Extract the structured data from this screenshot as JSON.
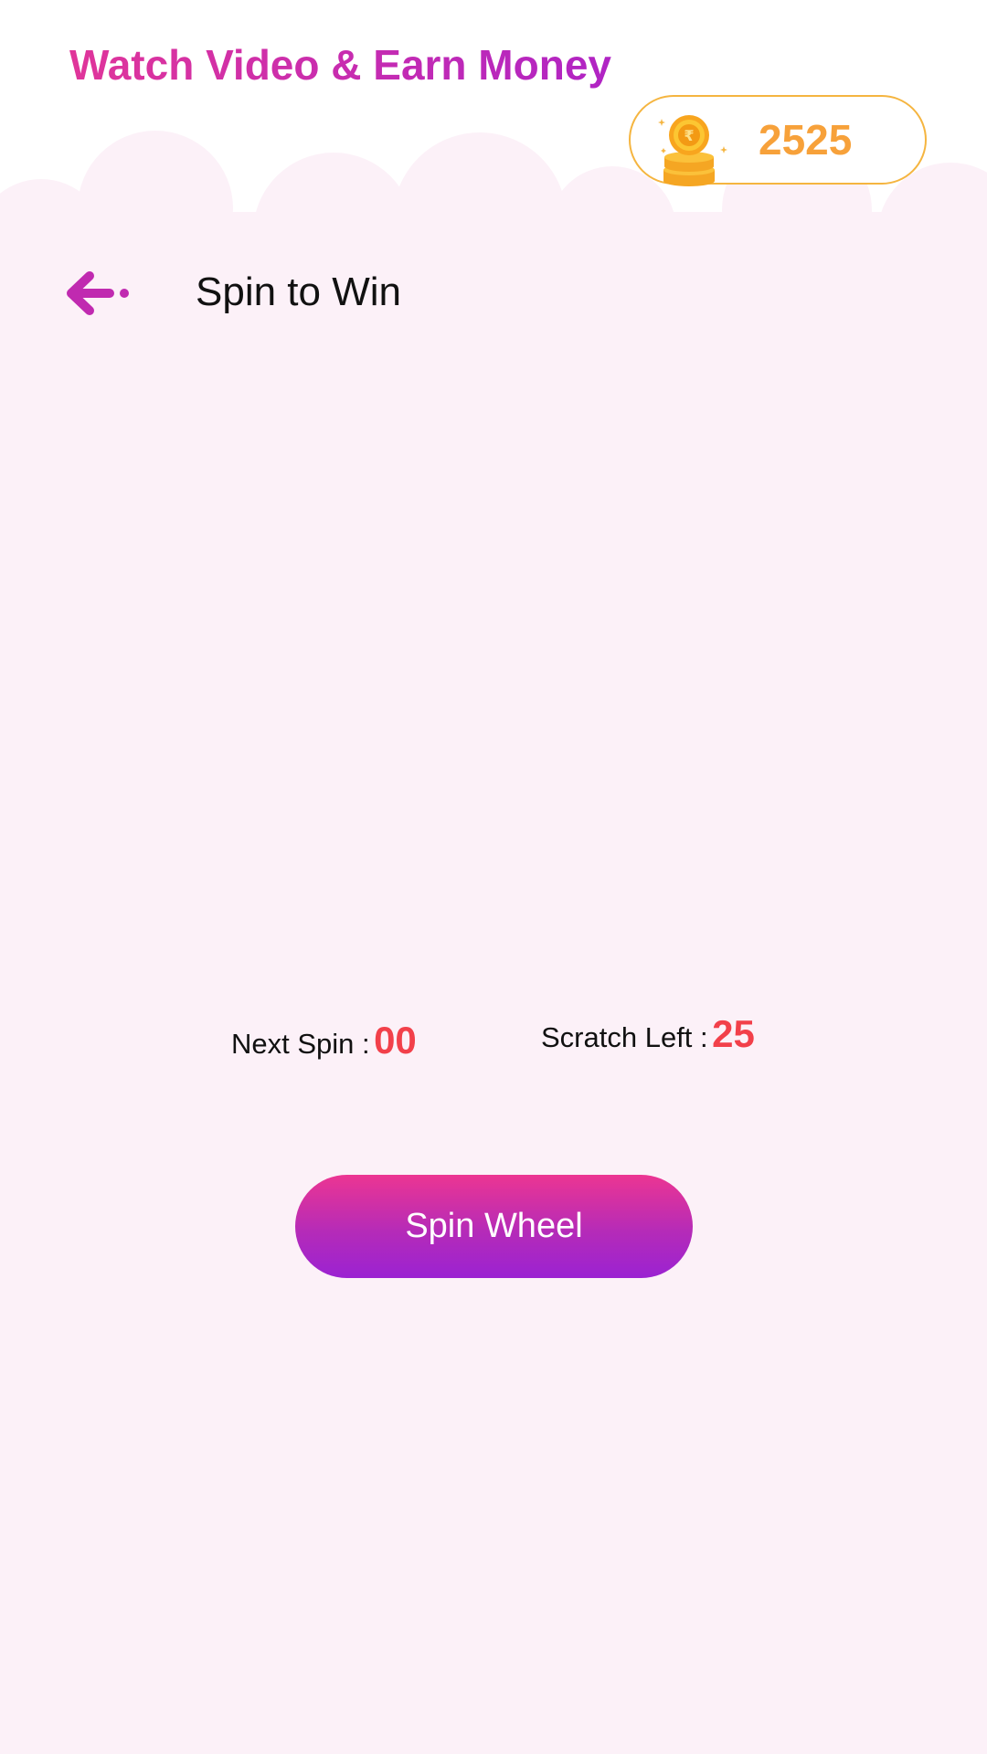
{
  "header": {
    "app_title": "Watch Video & Earn Money",
    "coin_balance": "2525",
    "coin_icon": "rupee-coin-stack-icon"
  },
  "screen": {
    "back_icon": "arrow-left-icon",
    "title": "Spin to Win"
  },
  "stats": {
    "next_spin_label": "Next Spin :",
    "next_spin_value": "00",
    "scratch_left_label": "Scratch Left :",
    "scratch_left_value": "25"
  },
  "actions": {
    "spin_button_label": "Spin Wheel"
  },
  "colors": {
    "title_gradient_start": "#e0359a",
    "title_gradient_end": "#b024c4",
    "coin_text": "#f7a13a",
    "coin_border": "#f5b540",
    "stat_value": "#f2404a",
    "button_gradient_top": "#ec3592",
    "button_gradient_bottom": "#9b22d2",
    "background_tint": "#fcf1f8"
  }
}
